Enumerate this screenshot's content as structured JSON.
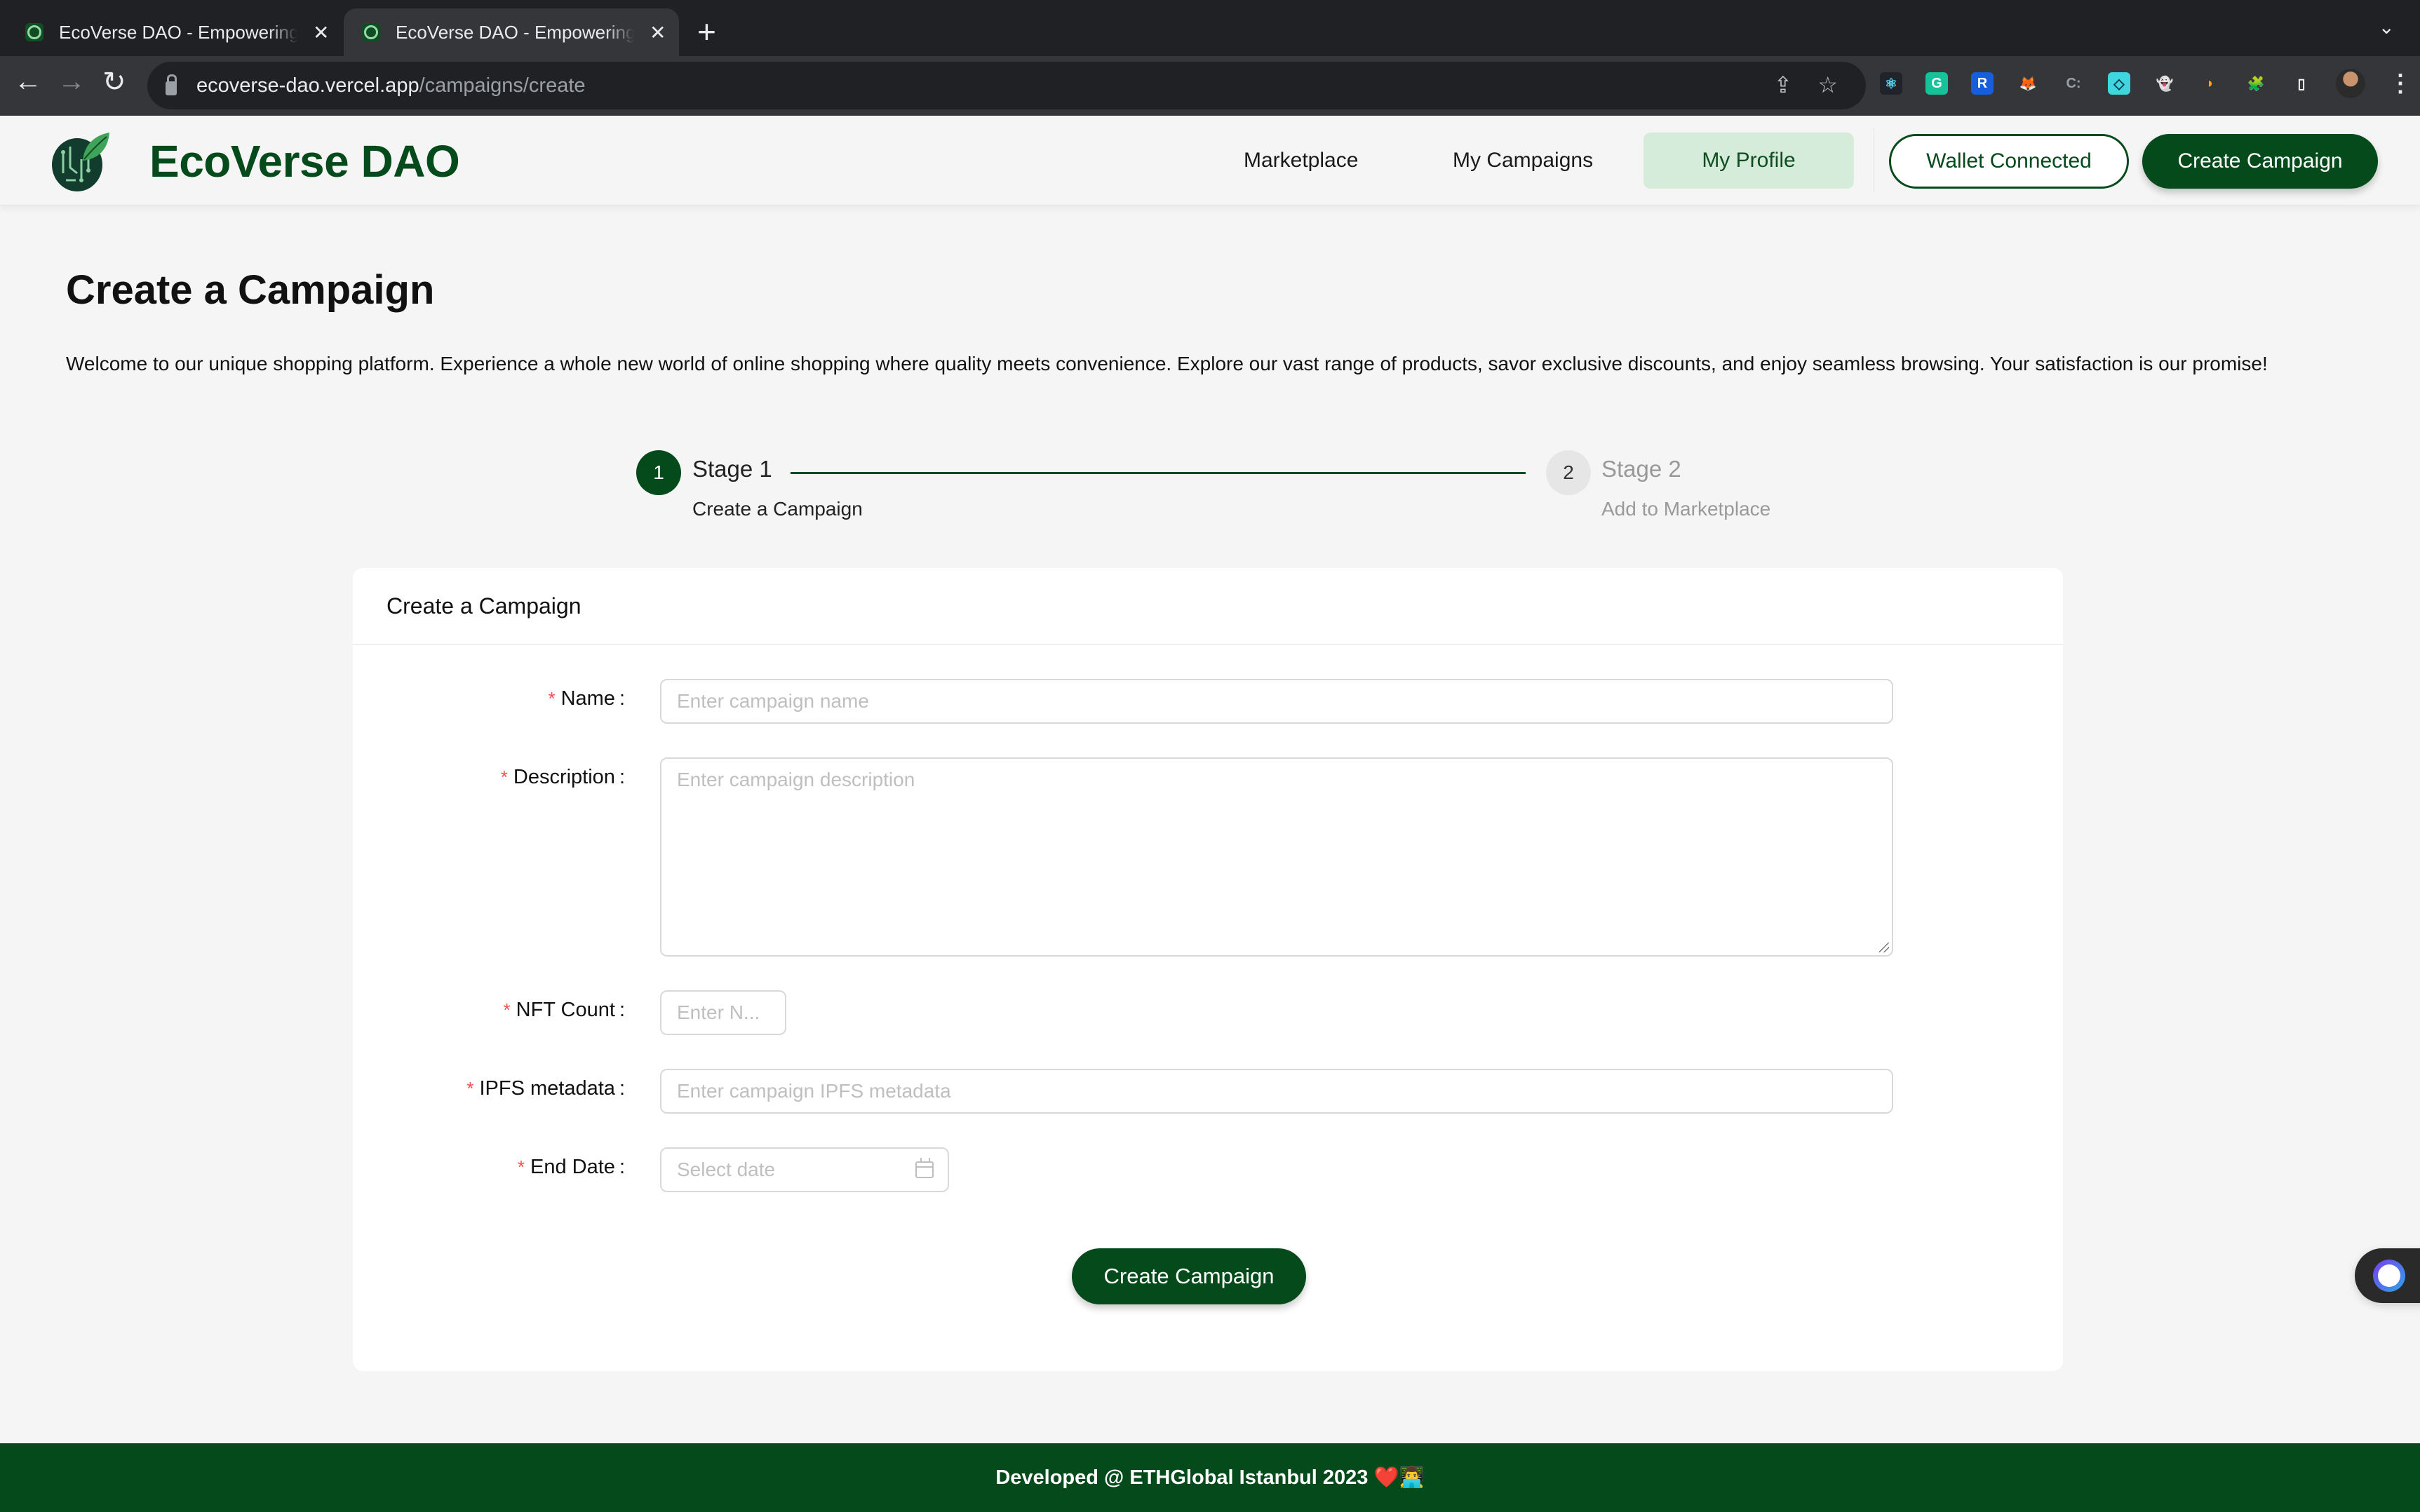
{
  "browser": {
    "tabs": [
      {
        "title": "EcoVerse DAO - Empowering E",
        "active": false
      },
      {
        "title": "EcoVerse DAO - Empowering E",
        "active": true
      }
    ],
    "close_glyph": "✕",
    "new_tab_glyph": "+",
    "tab_menu_glyph": "⌄",
    "back_glyph": "←",
    "forward_glyph": "→",
    "reload_glyph": "↻",
    "url_host": "ecoverse-dao.vercel.app",
    "url_path": "/campaigns/create",
    "share_glyph": "⇪",
    "star_glyph": "☆",
    "extensions": [
      {
        "name": "react-devtools",
        "glyph": "⚛",
        "color": "#61dafb",
        "bg": "#20232a"
      },
      {
        "name": "grammarly",
        "glyph": "G",
        "color": "#ffffff",
        "bg": "#15c39a"
      },
      {
        "name": "bitwarden",
        "glyph": "R",
        "color": "#ffffff",
        "bg": "#175ddc"
      },
      {
        "name": "metamask",
        "glyph": "🦊",
        "color": "#ffffff",
        "bg": "transparent"
      },
      {
        "name": "c-extension",
        "glyph": "C:",
        "color": "#9aa0a6",
        "bg": "transparent"
      },
      {
        "name": "teal-extension",
        "glyph": "◇",
        "color": "#0b3b4d",
        "bg": "#3fd6e0"
      },
      {
        "name": "phantom",
        "glyph": "👻",
        "color": "#ab9ff2",
        "bg": "transparent"
      },
      {
        "name": "yellow-extension",
        "glyph": "◗",
        "color": "#f5a623",
        "bg": "transparent"
      },
      {
        "name": "extensions-puzzle",
        "glyph": "🧩",
        "color": "#ffffff",
        "bg": "transparent"
      },
      {
        "name": "side-panel",
        "glyph": "▯",
        "color": "#ffffff",
        "bg": "transparent"
      }
    ],
    "menu_glyph": "⋮"
  },
  "header": {
    "brand": "EcoVerse DAO",
    "nav": [
      "Marketplace",
      "My Campaigns",
      "My Profile"
    ],
    "active_nav": "My Profile",
    "wallet_button": "Wallet Connected",
    "create_button": "Create Campaign"
  },
  "page": {
    "title": "Create a Campaign",
    "intro": "Welcome to our unique shopping platform. Experience a whole new world of online shopping where quality meets convenience. Explore our vast range of products, savor exclusive discounts, and enjoy seamless browsing. Your satisfaction is our promise!"
  },
  "steps": [
    {
      "number": "1",
      "title": "Stage 1",
      "description": "Create a Campaign",
      "status": "active"
    },
    {
      "number": "2",
      "title": "Stage 2",
      "description": "Add to Marketplace",
      "status": "waiting"
    }
  ],
  "form": {
    "card_title": "Create a Campaign",
    "required_mark": "*",
    "colon": ":",
    "fields": {
      "name": {
        "label": "Name",
        "placeholder": "Enter campaign name",
        "value": ""
      },
      "description": {
        "label": "Description",
        "placeholder": "Enter campaign description",
        "value": ""
      },
      "nft_count": {
        "label": "NFT Count",
        "placeholder": "Enter N...",
        "value": ""
      },
      "ipfs": {
        "label": "IPFS metadata",
        "placeholder": "Enter campaign IPFS metadata",
        "value": ""
      },
      "end_date": {
        "label": "End Date",
        "placeholder": "Select date",
        "value": ""
      }
    },
    "submit": "Create Campaign"
  },
  "footer": {
    "text": "Developed @ ETHGlobal Istanbul 2023 ❤️👨‍💻"
  },
  "colors": {
    "brand_green": "#044a1b",
    "active_nav_bg": "#d6ecda",
    "required_red": "#ff4d4f"
  }
}
